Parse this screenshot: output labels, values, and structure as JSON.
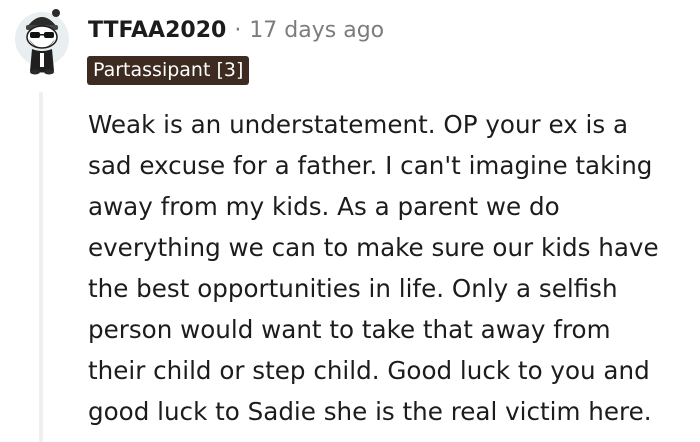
{
  "comment": {
    "username": "TTFAA2020",
    "separator": "·",
    "timestamp": "17 days ago",
    "flair": "Partassipant [3]",
    "avatar_icon": "snoo-avatar-icon",
    "body_lines": [
      "Weak is an understatement. OP your ex is a",
      "sad excuse for a father. I can't imagine taking",
      "away from my kids. As a parent we do",
      "everything we can to make sure our kids have",
      "the best opportunities in life. Only a selfish",
      "person would want to take that away from",
      "their child or step child. Good luck to you and",
      "good luck to Sadie she is the real victim here."
    ]
  },
  "colors": {
    "text": "#1c1c1c",
    "meta": "#7c7c7c",
    "flair_bg": "#3d2b22",
    "flair_text": "#ffffff",
    "thread_line": "#edeff1"
  }
}
